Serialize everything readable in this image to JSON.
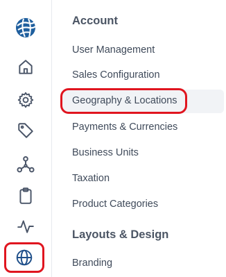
{
  "rail": {
    "items": [
      {
        "name": "logo",
        "icon": "globe-logo-icon"
      },
      {
        "name": "home",
        "icon": "home-icon"
      },
      {
        "name": "settings",
        "icon": "gear-icon"
      },
      {
        "name": "tags",
        "icon": "tag-icon"
      },
      {
        "name": "integrations",
        "icon": "hub-icon"
      },
      {
        "name": "clipboard",
        "icon": "clipboard-icon"
      },
      {
        "name": "activity",
        "icon": "pulse-icon"
      },
      {
        "name": "geography",
        "icon": "globe-icon",
        "highlighted": true
      }
    ]
  },
  "menu": {
    "sections": [
      {
        "title": "Account",
        "items": [
          "User Management",
          "Sales Configuration",
          "Geography & Locations",
          "Payments & Currencies",
          "Business Units",
          "Taxation",
          "Product Categories"
        ]
      },
      {
        "title": "Layouts & Design",
        "items": [
          "Branding"
        ]
      }
    ],
    "active_item": "Geography & Locations"
  },
  "colors": {
    "highlight_red": "#e0151f",
    "icon_gray": "#4a5568",
    "logo_blue": "#1f5f9e"
  }
}
